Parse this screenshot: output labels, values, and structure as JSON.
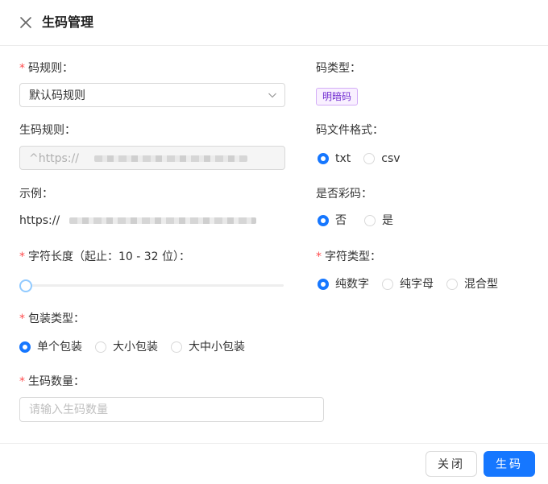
{
  "dialog": {
    "title": "生码管理",
    "close_icon": "close-icon"
  },
  "form": {
    "code_rule": {
      "required_mark": "*",
      "label": "码规则：",
      "value": "默认码规则"
    },
    "code_type": {
      "label": "码类型：",
      "tag": "明暗码",
      "tag_color": "#722ed1"
    },
    "gen_rule": {
      "label": "生码规则：",
      "value_prefix": "^https://"
    },
    "file_format": {
      "label": "码文件格式：",
      "options": [
        "txt",
        "csv"
      ],
      "selected": "txt"
    },
    "example": {
      "label": "示例：",
      "value_prefix": "https://"
    },
    "is_color": {
      "label": "是否彩码：",
      "options": [
        "否",
        "是"
      ],
      "selected": "否"
    },
    "char_length": {
      "required_mark": "*",
      "label": "字符长度（起止：10 - 32 位）：",
      "min": 10,
      "max": 32,
      "value": 10
    },
    "char_type": {
      "required_mark": "*",
      "label": "字符类型：",
      "options": [
        "纯数字",
        "纯字母",
        "混合型"
      ],
      "selected": "纯数字"
    },
    "pack_type": {
      "required_mark": "*",
      "label": "包装类型：",
      "options": [
        "单个包装",
        "大小包装",
        "大中小包装"
      ],
      "selected": "单个包装"
    },
    "gen_count": {
      "required_mark": "*",
      "label": "生码数量：",
      "placeholder": "请输入生码数量"
    }
  },
  "footer": {
    "close_label": "关闭",
    "submit_label": "生码"
  },
  "colors": {
    "primary": "#1677ff",
    "required": "#ff4d4f"
  }
}
